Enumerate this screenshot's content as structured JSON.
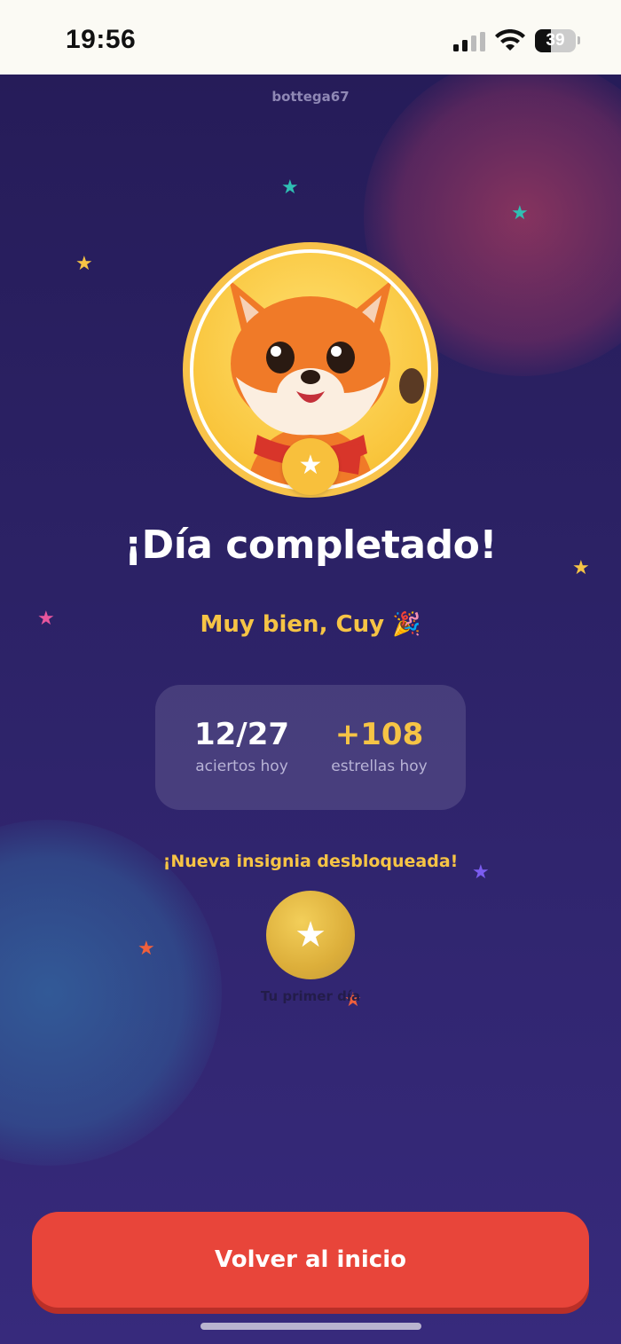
{
  "status_bar": {
    "time": "19:56",
    "battery": "39"
  },
  "app": {
    "username": "bottega67",
    "title": "¡Día completado!",
    "subtitle": "Muy bien, Cuy 🎉",
    "avatar_character": "fox-mascot",
    "avatar_badge_icon": "star-icon"
  },
  "stats": {
    "correct_value": "12/27",
    "correct_label": "aciertos hoy",
    "stars_value": "+108",
    "stars_label": "estrellas hoy"
  },
  "badge": {
    "heading": "¡Nueva insignia desbloqueada!",
    "icon": "star-icon",
    "name": "Tu primer día"
  },
  "actions": {
    "home_label": "Volver al inicio"
  },
  "colors": {
    "background_top": "#261c59",
    "background_bottom": "#372a7c",
    "accent_yellow": "#f6c445",
    "button_red": "#e8453a",
    "star_teal": "#2fbfb3",
    "star_pink": "#e8569d",
    "star_purple": "#7b5cf0",
    "star_orange": "#f0603c"
  }
}
